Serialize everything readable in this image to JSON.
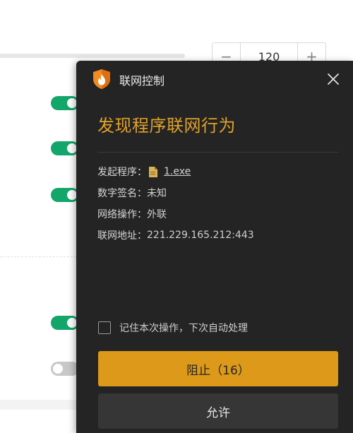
{
  "background": {
    "stepper": {
      "minus": "−",
      "value": "120",
      "plus": "+"
    },
    "toggles": [
      {
        "state": "on"
      },
      {
        "state": "on"
      },
      {
        "state": "on"
      },
      {
        "state": "on"
      },
      {
        "state": "off"
      }
    ]
  },
  "dialog": {
    "title": "联网控制",
    "headline": "发现程序联网行为",
    "fields": {
      "program_label": "发起程序：",
      "program_file": "1.exe",
      "signature_label": "数字签名：",
      "signature_value": "未知",
      "operation_label": "网络操作：",
      "operation_value": "外联",
      "address_label": "联网地址：",
      "address_value": "221.229.165.212:443"
    },
    "remember_label": "记住本次操作，下次自动处理",
    "remember_checked": false,
    "block_label": "阻止（16）",
    "allow_label": "允许",
    "colors": {
      "accent": "#dc991a",
      "headline": "#e0a22a",
      "background": "#242424",
      "toggle_on": "#13a66b"
    },
    "icons": [
      "shield-flame-icon",
      "close-icon",
      "folder-file-icon",
      "checkbox-icon"
    ]
  }
}
